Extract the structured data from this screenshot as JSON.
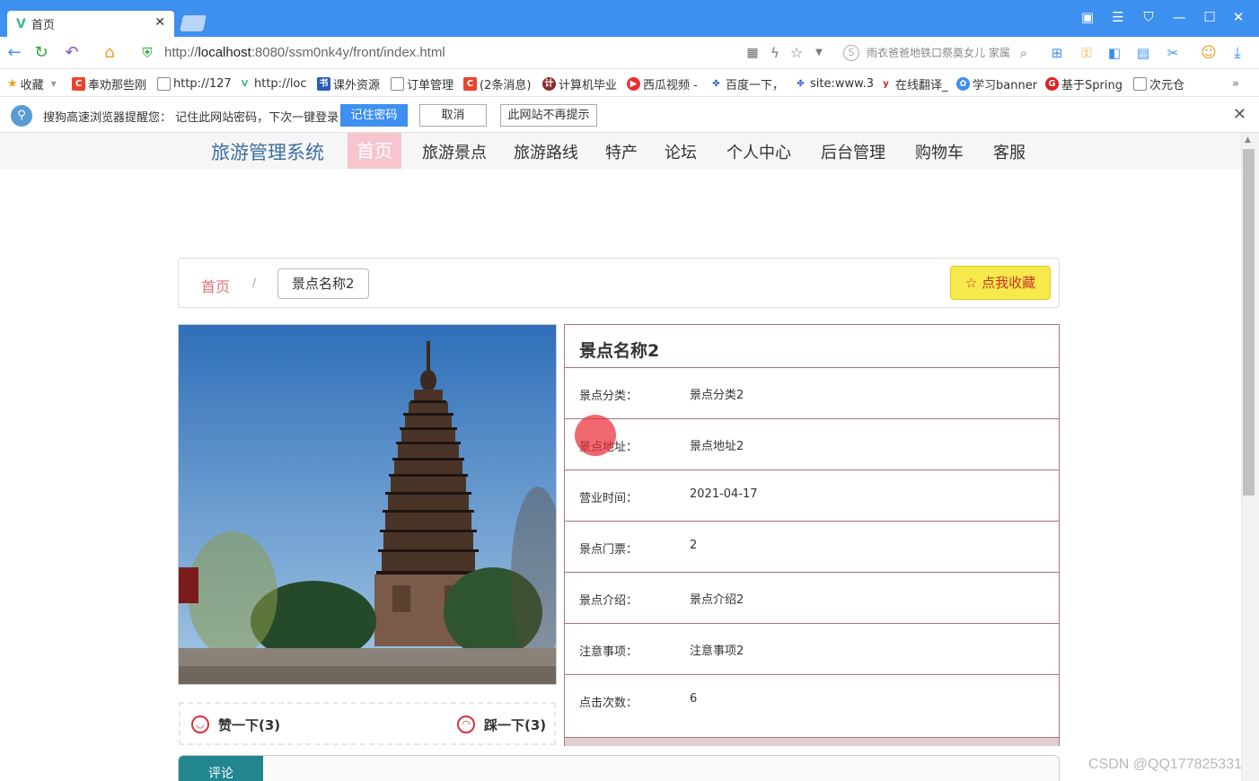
{
  "browser": {
    "tab_title": "首页",
    "url_prefix": "http://",
    "url_host": "localhost",
    "url_rest": ":8080/ssm0nk4y/front/index.html",
    "search_placeholder": "雨衣爸爸地铁口祭奠女儿 家属",
    "bookmarks": [
      "收藏",
      "奉劝那些刚",
      "http://127",
      "http://loc",
      "课外资源",
      "订单管理",
      "(2条消息)",
      "计算机毕业",
      "西瓜视频 -",
      "百度一下，",
      "site:www.3",
      "在线翻译_",
      "学习banner",
      "基于Spring",
      "次元仓"
    ],
    "password_bar": {
      "message": "搜狗高速浏览器提醒您： 记住此网站密码，下次一键登录！",
      "remember": "记住密码",
      "cancel": "取消",
      "never": "此网站不再提示"
    }
  },
  "site": {
    "title": "旅游管理系统",
    "nav": [
      "首页",
      "旅游景点",
      "旅游路线",
      "特产",
      "论坛",
      "个人中心",
      "后台管理",
      "购物车",
      "客服"
    ]
  },
  "breadcrumb": {
    "home": "首页",
    "separator": "/",
    "current": "景点名称2",
    "favorite": "点我收藏"
  },
  "detail": {
    "title": "景点名称2",
    "rows": [
      {
        "label": "景点分类：",
        "value": "景点分类2"
      },
      {
        "label": "景点地址：",
        "value": "景点地址2"
      },
      {
        "label": "营业时间：",
        "value": "2021-04-17"
      },
      {
        "label": "景点门票：",
        "value": "2"
      },
      {
        "label": "景点介绍：",
        "value": "景点介绍2"
      },
      {
        "label": "注意事项：",
        "value": "注意事项2"
      },
      {
        "label": "点击次数：",
        "value": "6"
      }
    ]
  },
  "votes": {
    "like": "赞一下(3)",
    "dislike": "踩一下(3)"
  },
  "tabs": {
    "comment": "评论"
  },
  "watermark": "CSDN @QQ177825331",
  "colors": {
    "browser_blue": "#3d8ff0",
    "nav_active": "#f7c5ce",
    "favorite_bg": "#f6e94b",
    "detail_border": "#b0707a",
    "tab_teal": "#21868f"
  }
}
